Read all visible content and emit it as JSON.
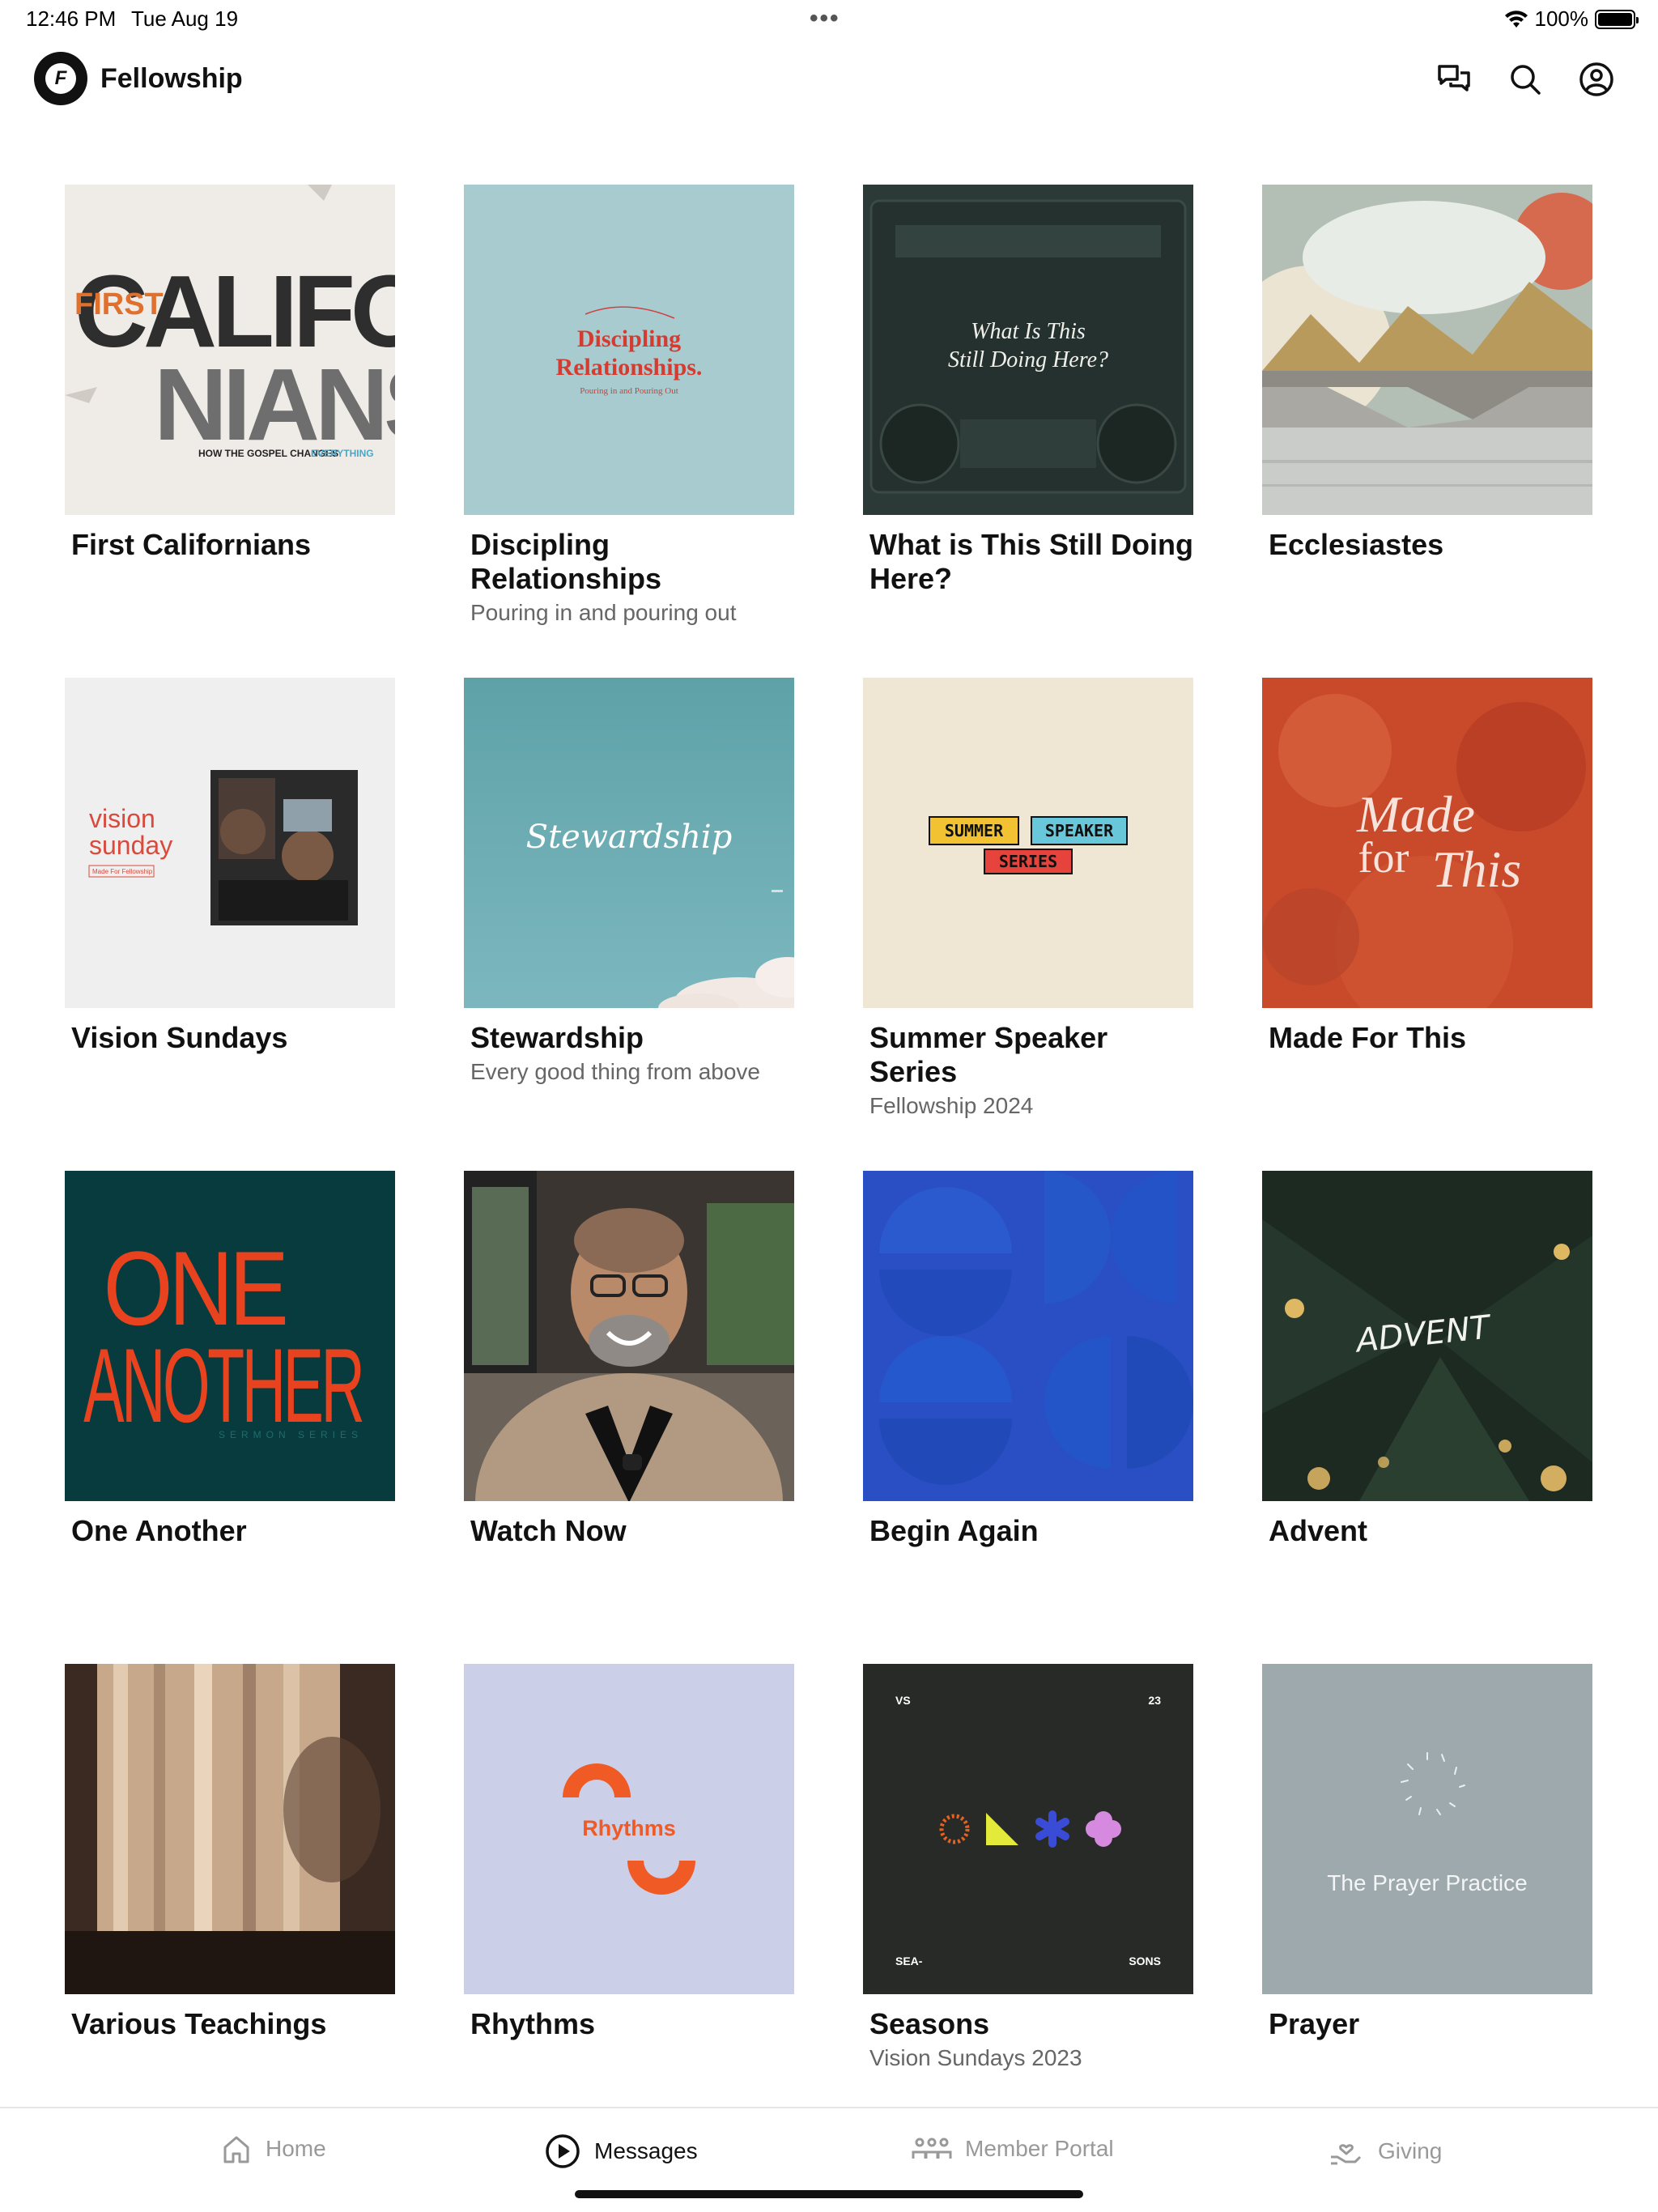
{
  "status": {
    "time": "12:46 PM",
    "date": "Tue Aug 19",
    "battery": "100%"
  },
  "header": {
    "title": "Fellowship",
    "logo_letter": "F"
  },
  "cards": [
    {
      "title": "First Californians",
      "subtitle": "",
      "art": {
        "line1": "CALIFOR",
        "line2": "NIANS",
        "tag": "FIRST",
        "footer": "HOW THE GOSPEL CHANGES",
        "footer_accent": "EVERYTHING"
      }
    },
    {
      "title": "Discipling Relationships",
      "subtitle": "Pouring in and pouring out",
      "art": {
        "line1": "Discipling",
        "line2": "Relationships.",
        "small": "Pouring in and Pouring Out"
      }
    },
    {
      "title": "What is This Still Doing Here?",
      "subtitle": "",
      "art": {
        "line1": "What Is This",
        "line2": "Still Doing Here?"
      }
    },
    {
      "title": "Ecclesiastes",
      "subtitle": "",
      "art": {}
    },
    {
      "title": "Vision Sundays",
      "subtitle": "",
      "art": {
        "line1": "vision",
        "line2": "sunday",
        "small": "Made For Fellowship"
      }
    },
    {
      "title": "Stewardship",
      "subtitle": "Every good thing from above",
      "art": {
        "line1": "Stewardship"
      }
    },
    {
      "title": "Summer Speaker Series",
      "subtitle": "Fellowship 2024",
      "art": {
        "w1": "SUMMER",
        "w2": "SPEAKER",
        "w3": "SERIES"
      }
    },
    {
      "title": "Made For This",
      "subtitle": "",
      "art": {
        "line1": "Made",
        "line2": "for",
        "line3": "This"
      }
    },
    {
      "title": "One Another",
      "subtitle": "",
      "art": {
        "line1": "ONE",
        "line2": "ANOTHER",
        "small": "SERMON SERIES"
      }
    },
    {
      "title": "Watch Now",
      "subtitle": "",
      "art": {}
    },
    {
      "title": "Begin Again",
      "subtitle": "",
      "art": {}
    },
    {
      "title": "Advent",
      "subtitle": "",
      "art": {
        "line1": "ADVENT"
      }
    },
    {
      "title": "Various Teachings",
      "subtitle": "",
      "art": {}
    },
    {
      "title": "Rhythms",
      "subtitle": "",
      "art": {
        "line1": "Rhythms"
      }
    },
    {
      "title": "Seasons",
      "subtitle": "Vision Sundays 2023",
      "art": {
        "tl": "VS",
        "tr": "23",
        "bl": "SEA-",
        "br": "SONS"
      }
    },
    {
      "title": "Prayer",
      "subtitle": "",
      "art": {
        "line1": "The Prayer Practice"
      }
    }
  ],
  "tabs": [
    {
      "label": "Home",
      "icon": "home-icon"
    },
    {
      "label": "Messages",
      "icon": "play-circle-icon"
    },
    {
      "label": "Member Portal",
      "icon": "people-icon"
    },
    {
      "label": "Giving",
      "icon": "giving-hand-icon"
    }
  ],
  "active_tab": "Messages",
  "colors": {
    "accent": "#111111",
    "muted": "#999999",
    "subtitle": "#666666"
  }
}
